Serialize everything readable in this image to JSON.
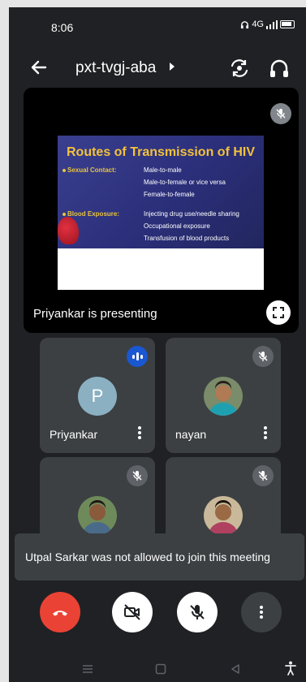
{
  "status_bar": {
    "time": "8:06",
    "network": "4G"
  },
  "header": {
    "meeting_code": "pxt-tvgj-aba"
  },
  "presentation": {
    "label": "Priyankar is presenting",
    "slide": {
      "title": "Routes of Transmission of HIV",
      "section1_label": "Sexual Contact:",
      "section1_items": [
        "Male-to-male",
        "Male-to-female or vice versa",
        "Female-to-female"
      ],
      "section2_label": "Blood Exposure:",
      "section2_items": [
        "Injecting drug use/needle sharing",
        "Occupational exposure",
        "Transfusion of blood products"
      ]
    }
  },
  "participants": [
    {
      "name": "Priyankar",
      "initial": "P",
      "status": "speaking"
    },
    {
      "name": "nayan",
      "status": "muted"
    },
    {
      "name": "",
      "status": "muted"
    },
    {
      "name": "",
      "status": "muted"
    }
  ],
  "toast": {
    "message": "Utpal Sarkar was not allowed to join this meeting"
  },
  "colors": {
    "end_call": "#ea4335",
    "speaking": "#1a57d2",
    "tile": "#3c4043",
    "background": "#202124"
  }
}
